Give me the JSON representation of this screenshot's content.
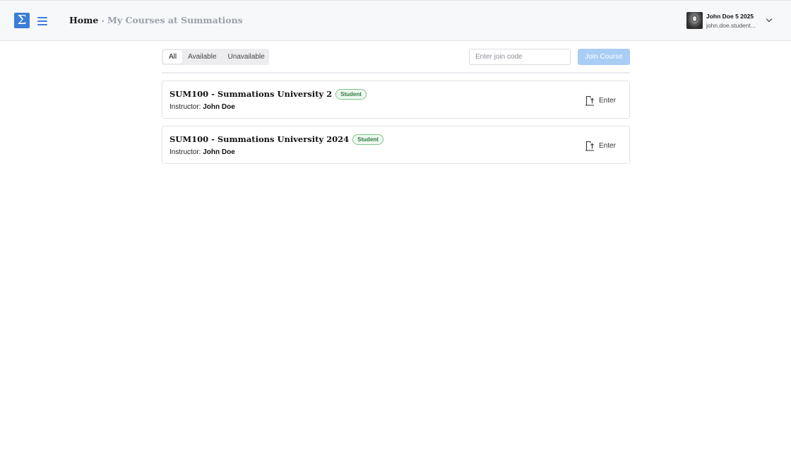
{
  "header": {
    "logo_glyph": "Σ",
    "breadcrumb": {
      "home": "Home",
      "separator": "•",
      "current": "My Courses at Summations"
    },
    "user": {
      "name": "John Doe 5 2025",
      "email": "john.doe.student..."
    },
    "brand_color": "#3b7dd8"
  },
  "filters": {
    "tabs": [
      "All",
      "Available",
      "Unavailable"
    ],
    "active": "All"
  },
  "join": {
    "placeholder": "Enter join code",
    "button_label": "Join Course",
    "button_color": "#a9cdf5"
  },
  "courses": [
    {
      "title": "SUM100 - Summations University 2",
      "role": "Student",
      "instructor_label": "Instructor:",
      "instructor": "John Doe",
      "enter_label": "Enter",
      "enter_icon": "enter-door-icon"
    },
    {
      "title": "SUM100 - Summations University 2024",
      "role": "Student",
      "instructor_label": "Instructor:",
      "instructor": "John Doe",
      "enter_label": "Enter",
      "enter_icon": "enter-door-icon"
    }
  ]
}
